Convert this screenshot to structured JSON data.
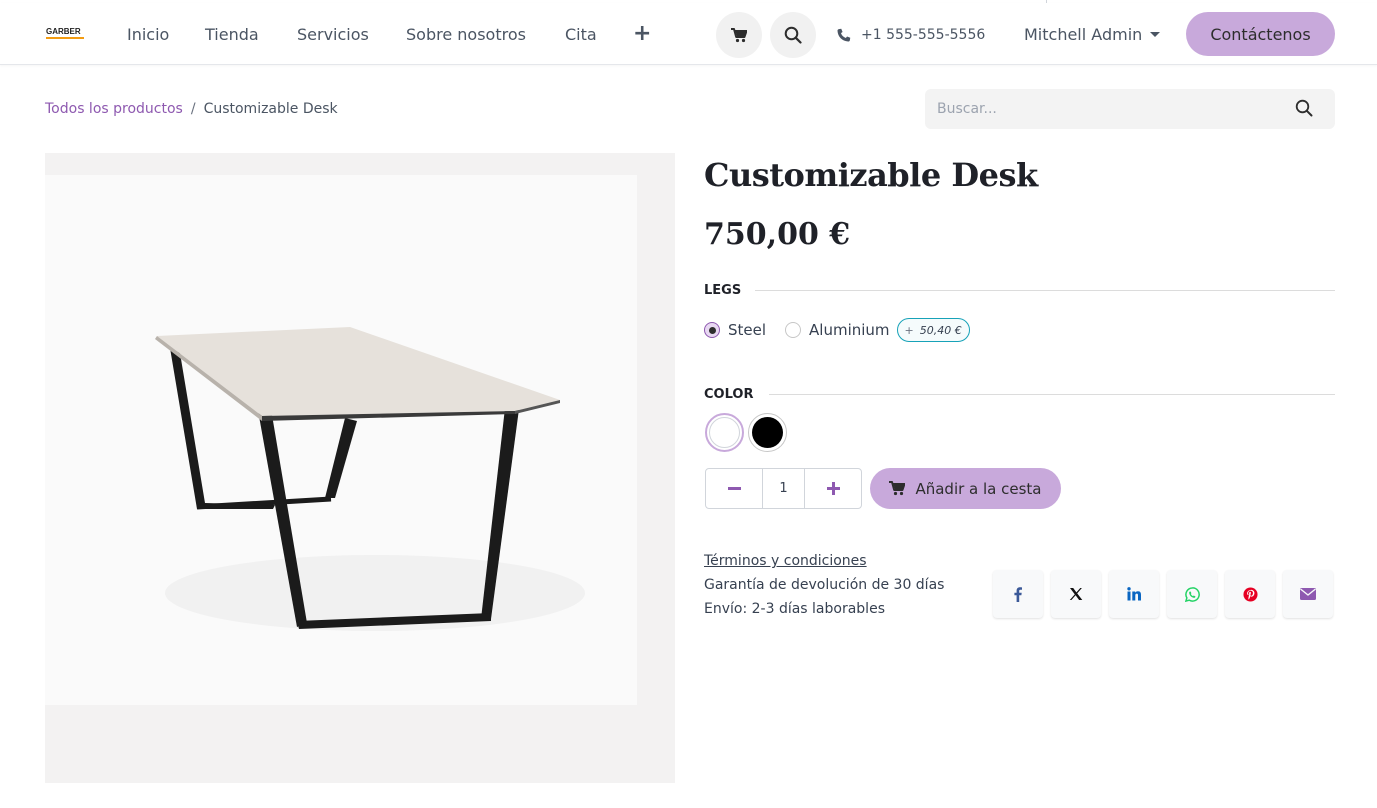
{
  "header": {
    "logo_text": "GARBER",
    "nav": [
      "Inicio",
      "Tienda",
      "Servicios",
      "Sobre nosotros",
      "Cita"
    ],
    "phone": "+1 555-555-5556",
    "user": "Mitchell Admin",
    "contact_label": "Contáctenos"
  },
  "breadcrumb": {
    "parent": "Todos los productos",
    "separator": "/",
    "current": "Customizable Desk"
  },
  "search": {
    "placeholder": "Buscar..."
  },
  "product": {
    "title": "Customizable Desk",
    "price": "750,00 €",
    "attributes": {
      "legs": {
        "label": "LEGS",
        "options": [
          {
            "label": "Steel",
            "selected": true
          },
          {
            "label": "Aluminium",
            "selected": false,
            "extra_price": "50,40 €",
            "extra_sign": "+"
          }
        ]
      },
      "color": {
        "label": "COLOR",
        "swatches": [
          {
            "name": "white",
            "hex": "#ffffff",
            "selected": true
          },
          {
            "name": "black",
            "hex": "#000000",
            "selected": false
          }
        ]
      }
    },
    "quantity": "1",
    "add_to_cart_label": "Añadir a la cesta",
    "terms_label": "Términos y condiciones",
    "guarantee": "Garantía de devolución de 30 días",
    "shipping": "Envío: 2-3 días laborables"
  },
  "share": [
    "facebook",
    "x",
    "linkedin",
    "whatsapp",
    "pinterest",
    "email"
  ],
  "colors": {
    "accent": "#c8a9db",
    "link": "#8e59b0",
    "badge_border": "#17a2b8"
  }
}
